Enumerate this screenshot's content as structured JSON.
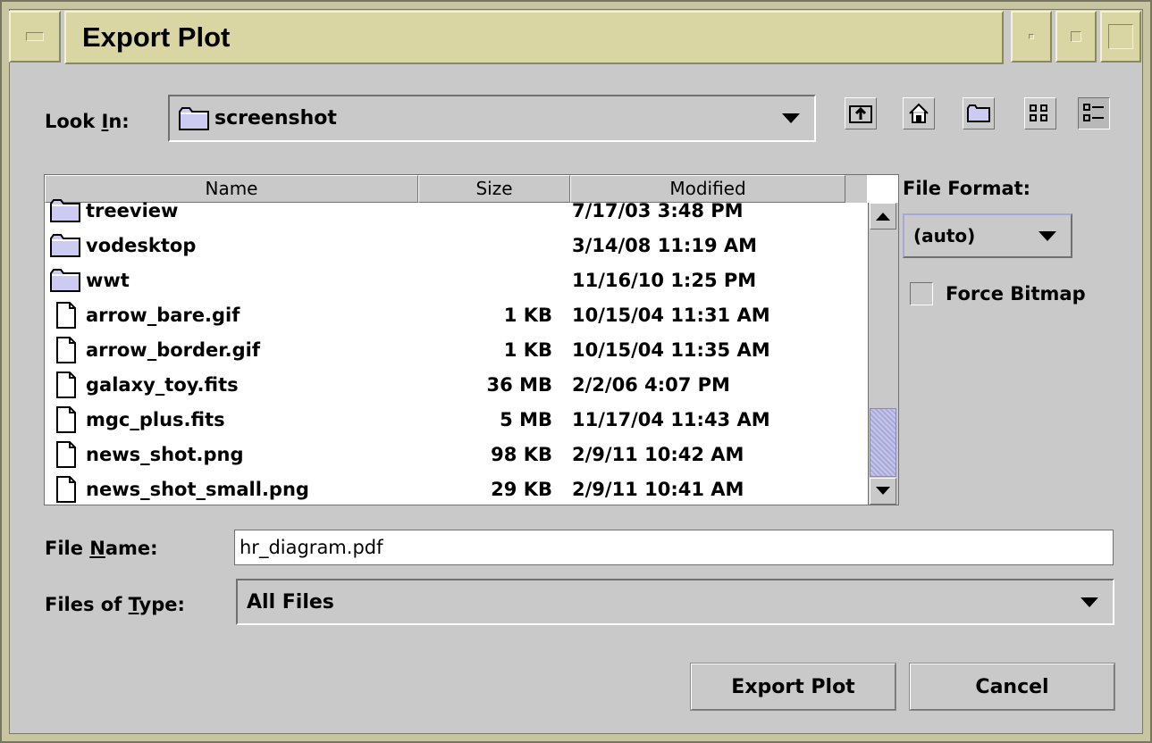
{
  "window": {
    "title": "Export Plot"
  },
  "look_in": {
    "label_pre": "Look ",
    "label_key": "I",
    "label_post": "n:",
    "value": "screenshot"
  },
  "toolbar": {
    "icons": [
      "up-folder-icon",
      "home-icon",
      "new-folder-icon",
      "list-view-icon",
      "details-view-icon"
    ]
  },
  "table": {
    "headers": [
      "Name",
      "Size",
      "Modified"
    ],
    "rows": [
      {
        "type": "folder",
        "name": "treeview",
        "size": "",
        "modified": "7/17/03 3:48 PM"
      },
      {
        "type": "folder",
        "name": "vodesktop",
        "size": "",
        "modified": "3/14/08 11:19 AM"
      },
      {
        "type": "folder",
        "name": "wwt",
        "size": "",
        "modified": "11/16/10 1:25 PM"
      },
      {
        "type": "file",
        "name": "arrow_bare.gif",
        "size": "1 KB",
        "modified": "10/15/04 11:31 AM"
      },
      {
        "type": "file",
        "name": "arrow_border.gif",
        "size": "1 KB",
        "modified": "10/15/04 11:35 AM"
      },
      {
        "type": "file",
        "name": "galaxy_toy.fits",
        "size": "36 MB",
        "modified": "2/2/06 4:07 PM"
      },
      {
        "type": "file",
        "name": "mgc_plus.fits",
        "size": "5 MB",
        "modified": "11/17/04 11:43 AM"
      },
      {
        "type": "file",
        "name": "news_shot.png",
        "size": "98 KB",
        "modified": "2/9/11 10:42 AM"
      },
      {
        "type": "file",
        "name": "news_shot_small.png",
        "size": "29 KB",
        "modified": "2/9/11 10:41 AM"
      }
    ]
  },
  "file_format": {
    "label": "File Format:",
    "value": "(auto)"
  },
  "force_bitmap": {
    "label": "Force Bitmap",
    "checked": false
  },
  "file_name": {
    "label_pre": "File ",
    "label_key": "N",
    "label_post": "ame:",
    "value": "hr_diagram.pdf"
  },
  "files_of_type": {
    "label_pre": "Files of ",
    "label_key": "T",
    "label_post": "ype:",
    "value": "All Files"
  },
  "buttons": {
    "export": "Export Plot",
    "cancel": "Cancel"
  },
  "colors": {
    "title_bar": "#d9d6a4",
    "scroll_thumb": "#b4b4e2",
    "background": "#c9c9c9"
  }
}
